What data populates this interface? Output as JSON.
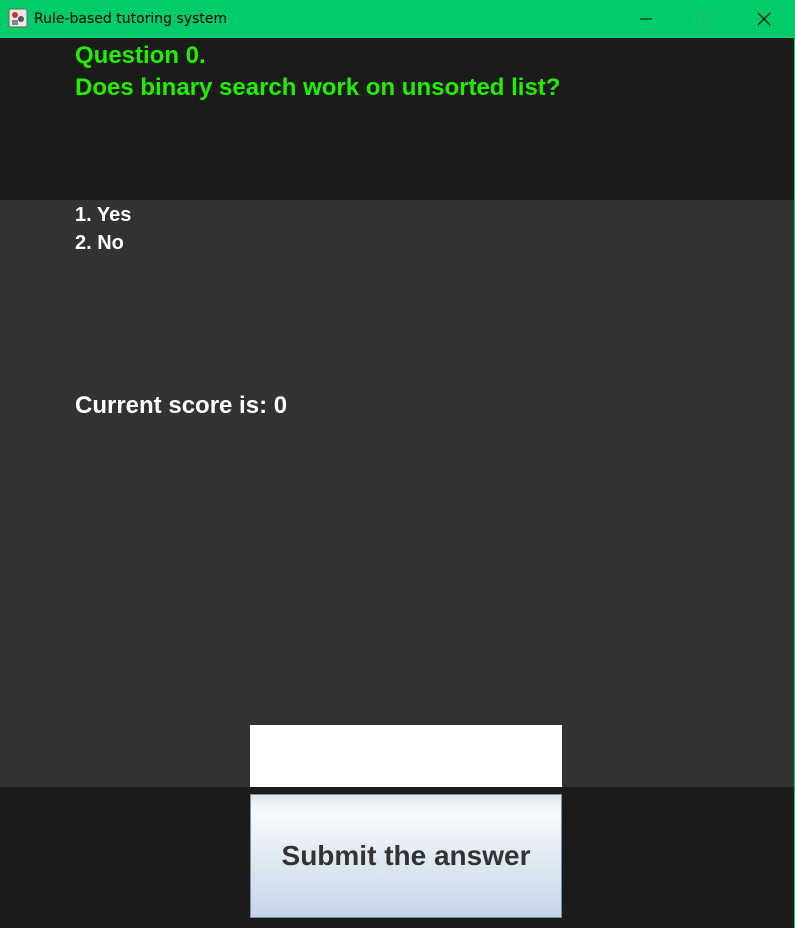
{
  "window": {
    "title": "Rule-based tutoring system",
    "accent_color": "#00cc6a",
    "icons": [
      "app-icon",
      "minimize-icon",
      "maximize-icon",
      "close-icon"
    ]
  },
  "question": {
    "number_text": "Question 0.",
    "text": "Does binary search work on unsorted list?",
    "color": "#22ee00"
  },
  "options": [
    {
      "label": "1. Yes"
    },
    {
      "label": "2. No"
    }
  ],
  "score": {
    "text": "Current score is: 0"
  },
  "answer_input": {
    "value": "",
    "placeholder": ""
  },
  "submit": {
    "label": "Submit the answer"
  }
}
